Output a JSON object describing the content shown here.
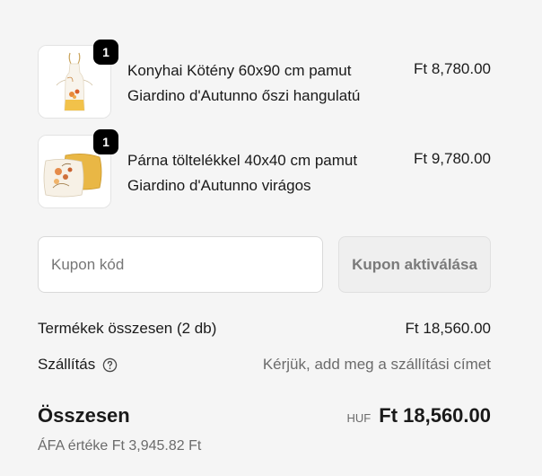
{
  "items": [
    {
      "title_line1": "Konyhai Kötény 60x90 cm pamut",
      "title_line2": "Giardino d'Autunno őszi hangulatú",
      "price": "Ft 8,780.00",
      "quantity": "1",
      "image_icon": "apron-product-icon"
    },
    {
      "title_line1": "Párna töltelékkel 40x40 cm pamut",
      "title_line2": "Giardino d'Autunno virágos",
      "price": "Ft 9,780.00",
      "quantity": "1",
      "image_icon": "cushion-product-icon"
    }
  ],
  "coupon": {
    "placeholder": "Kupon kód",
    "value": "",
    "button_label": "Kupon aktiválása"
  },
  "subtotal": {
    "label": "Termékek összesen (2 db)",
    "value": "Ft 18,560.00"
  },
  "shipping": {
    "label": "Szállítás",
    "value": "Kérjük, add meg a szállítási címet",
    "help_icon": "question-circle-icon"
  },
  "total": {
    "label": "Összesen",
    "currency": "HUF",
    "value": "Ft 18,560.00"
  },
  "tax": {
    "text": "ÁFA értéke Ft 3,945.82 Ft"
  },
  "colors": {
    "background": "#f5f5f5",
    "badge": "#000000",
    "muted_text": "#6b6b6b"
  }
}
